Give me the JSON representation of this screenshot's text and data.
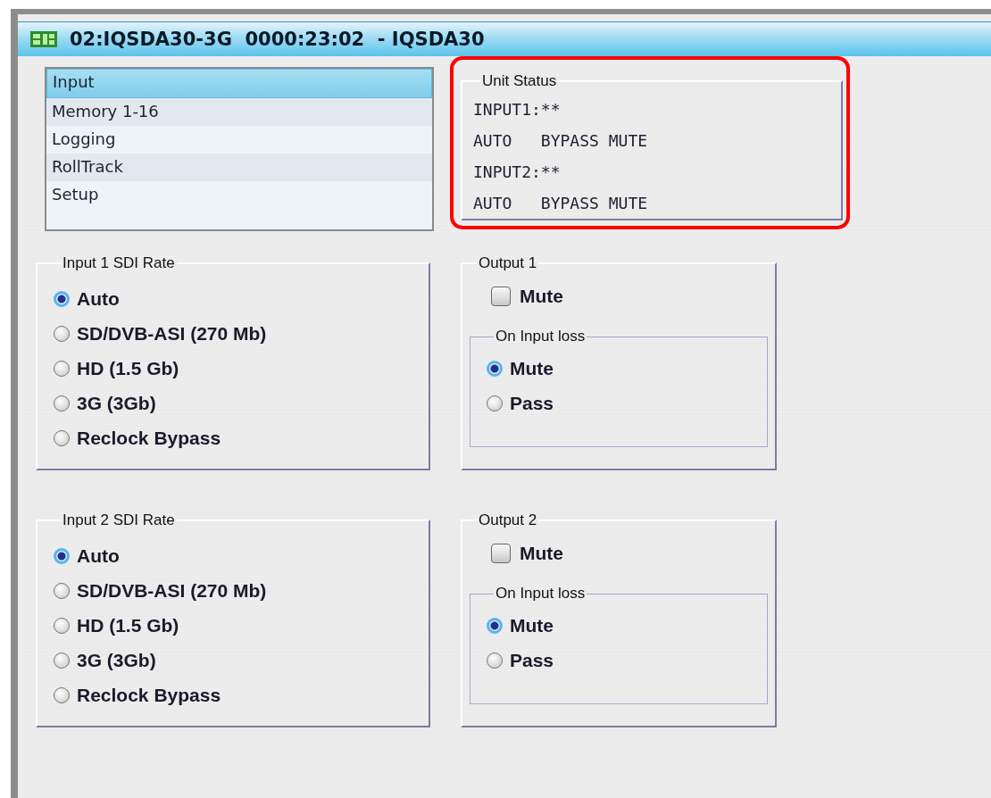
{
  "window": {
    "title": "02:IQSDA30-3G  0000:23:02  - IQSDA30"
  },
  "nav": {
    "items": [
      {
        "label": "Input",
        "selected": true
      },
      {
        "label": "Memory 1-16",
        "selected": false
      },
      {
        "label": "Logging",
        "selected": false
      },
      {
        "label": "RollTrack",
        "selected": false
      },
      {
        "label": "Setup",
        "selected": false
      }
    ]
  },
  "unit_status": {
    "title": "Unit Status",
    "highlighted": true,
    "lines": [
      "INPUT1:**",
      "AUTO   BYPASS MUTE",
      "INPUT2:**",
      "AUTO   BYPASS MUTE"
    ]
  },
  "inputs": [
    {
      "title": "Input 1 SDI Rate",
      "options": [
        {
          "label": "Auto",
          "selected": true
        },
        {
          "label": "SD/DVB-ASI (270 Mb)",
          "selected": false
        },
        {
          "label": "HD (1.5 Gb)",
          "selected": false
        },
        {
          "label": "3G (3Gb)",
          "selected": false
        },
        {
          "label": "Reclock Bypass",
          "selected": false
        }
      ]
    },
    {
      "title": "Input 2 SDI Rate",
      "options": [
        {
          "label": "Auto",
          "selected": true
        },
        {
          "label": "SD/DVB-ASI (270 Mb)",
          "selected": false
        },
        {
          "label": "HD (1.5 Gb)",
          "selected": false
        },
        {
          "label": "3G (3Gb)",
          "selected": false
        },
        {
          "label": "Reclock Bypass",
          "selected": false
        }
      ]
    }
  ],
  "outputs": [
    {
      "title": "Output 1",
      "mute": {
        "label": "Mute",
        "checked": false
      },
      "input_loss": {
        "title": "On Input loss",
        "options": [
          {
            "label": "Mute",
            "selected": true
          },
          {
            "label": "Pass",
            "selected": false
          }
        ]
      }
    },
    {
      "title": "Output 2",
      "mute": {
        "label": "Mute",
        "checked": false
      },
      "input_loss": {
        "title": "On Input loss",
        "options": [
          {
            "label": "Mute",
            "selected": true
          },
          {
            "label": "Pass",
            "selected": false
          }
        ]
      }
    }
  ]
}
